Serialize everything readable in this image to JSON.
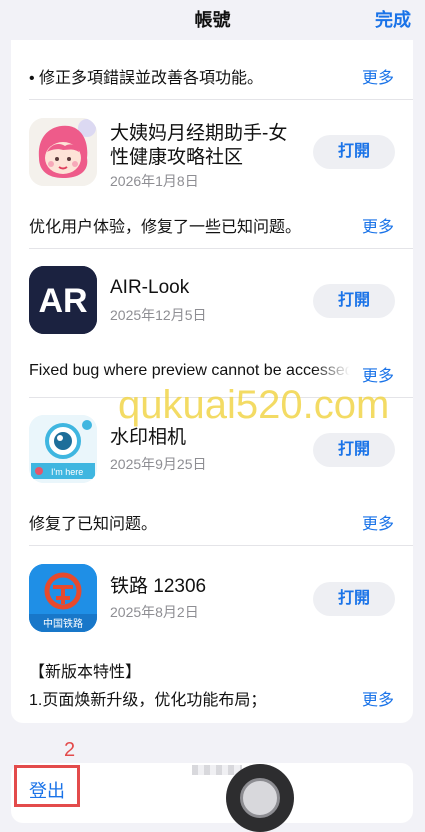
{
  "nav": {
    "title": "帳號",
    "done": "完成"
  },
  "top_note": {
    "text": "• 修正多項錯誤並改善各項功能。",
    "more": "更多"
  },
  "apps": [
    {
      "name": "大姨妈月经期助手-女性健康攻略社区",
      "date": "2026年1月8日",
      "open": "打開",
      "note": "优化用户体验，修复了一些已知问题。",
      "more": "更多",
      "icon": "period-tracker-girl-icon"
    },
    {
      "name": "AIR-Look",
      "date": "2025年12月5日",
      "open": "打開",
      "note": "Fixed bug where preview cannot be accessed",
      "more": "更多",
      "icon": "air-look-icon",
      "icon_text": "AR"
    },
    {
      "name": "水印相机",
      "date": "2025年9月25日",
      "open": "打開",
      "note": "修复了已知问题。",
      "more": "更多",
      "icon": "watermark-camera-icon",
      "icon_text": "I'm here"
    },
    {
      "name": "铁路 12306",
      "date": "2025年8月2日",
      "open": "打開",
      "note_title": "【新版本特性】",
      "note": "1.页面焕新升级，优化功能布局；",
      "more": "更多",
      "icon": "railway-12306-icon",
      "icon_text": "中国铁路"
    }
  ],
  "watermark": "qukuai520.com",
  "bottom": {
    "logout": "登出",
    "annotation": "2"
  },
  "colors": {
    "accent": "#1a73e8",
    "annotation": "#e34b4b",
    "background": "#f2f2f7"
  }
}
